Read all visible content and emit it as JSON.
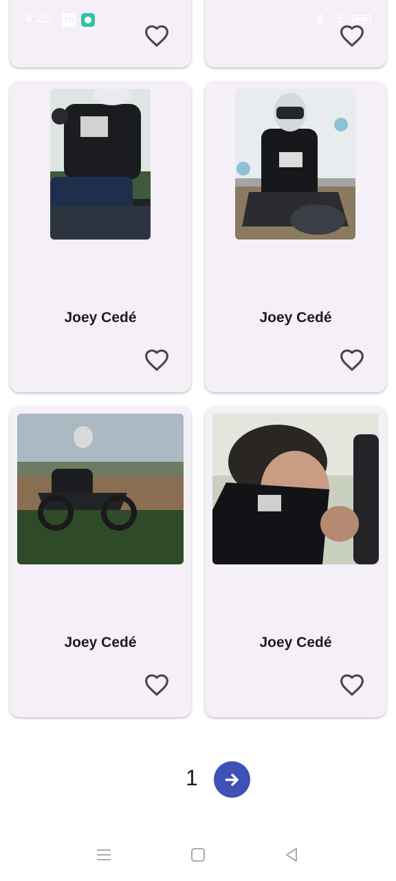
{
  "status_bar": {
    "time": "4:25",
    "icons": [
      "linkedin-icon",
      "chat-icon",
      "bluetooth-icon",
      "wifi-icon",
      "battery-icon"
    ]
  },
  "cards": [
    {
      "title": "",
      "favorite": false,
      "photo": "partial-top-left"
    },
    {
      "title": "",
      "favorite": false,
      "photo": "partial-top-right"
    },
    {
      "title": "Joey Cedé",
      "favorite": false,
      "photo": "rider-on-motorcycle-hoodie"
    },
    {
      "title": "Joey Cedé",
      "favorite": false,
      "photo": "rider-helmet-gloves-on-bike"
    },
    {
      "title": "Joey Cedé",
      "favorite": false,
      "photo": "rider-in-field-on-motorcycle"
    },
    {
      "title": "Joey Cedé",
      "favorite": false,
      "photo": "man-with-face-mask"
    }
  ],
  "pagination": {
    "current_page": "1",
    "next_icon": "arrow-right-icon"
  },
  "nav_bar": {
    "icons": [
      "menu-icon",
      "home-icon",
      "back-icon"
    ]
  },
  "colors": {
    "card_background": "#f5eff8",
    "accent": "#3f51b5",
    "text": "#1d1b20",
    "icon": "#49454f"
  }
}
